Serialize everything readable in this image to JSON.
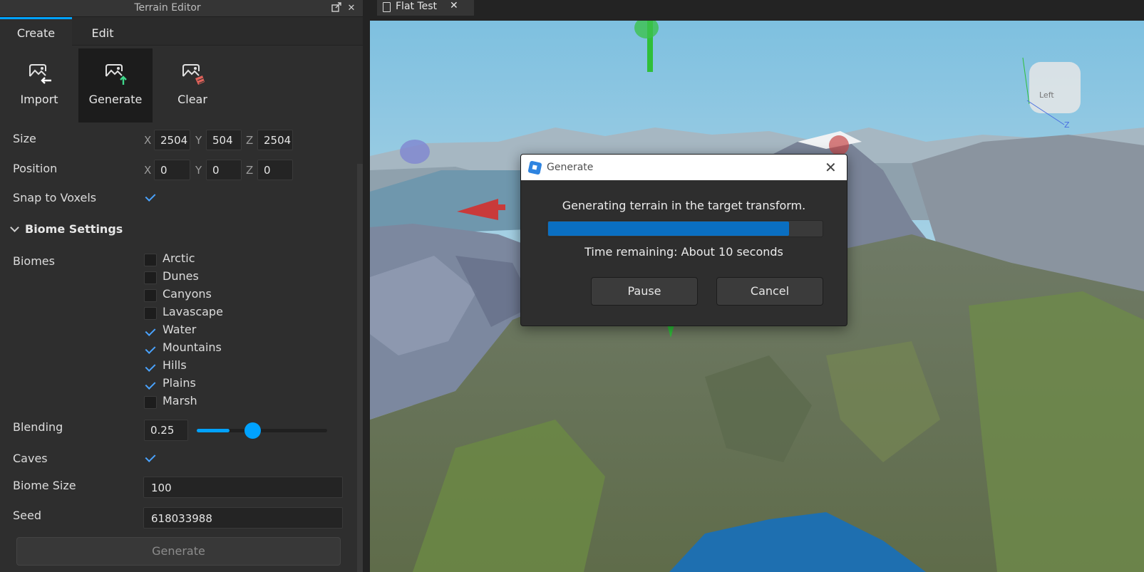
{
  "panel": {
    "title": "Terrain Editor",
    "tabs": [
      {
        "label": "Create",
        "active": true
      },
      {
        "label": "Edit",
        "active": false
      }
    ],
    "tools": [
      {
        "label": "Import",
        "icon": "import-icon"
      },
      {
        "label": "Generate",
        "icon": "generate-icon",
        "active": true
      },
      {
        "label": "Clear",
        "icon": "clear-icon"
      }
    ],
    "size": {
      "label": "Size",
      "x": "2504",
      "y": "504",
      "z": "2504"
    },
    "position": {
      "label": "Position",
      "x": "0",
      "y": "0",
      "z": "0"
    },
    "axes": {
      "x": "X",
      "y": "Y",
      "z": "Z"
    },
    "snap": {
      "label": "Snap to Voxels",
      "checked": true
    },
    "biome_section": "Biome Settings",
    "biomes_label": "Biomes",
    "biomes": [
      {
        "label": "Arctic",
        "checked": false
      },
      {
        "label": "Dunes",
        "checked": false
      },
      {
        "label": "Canyons",
        "checked": false
      },
      {
        "label": "Lavascape",
        "checked": false
      },
      {
        "label": "Water",
        "checked": true
      },
      {
        "label": "Mountains",
        "checked": true
      },
      {
        "label": "Hills",
        "checked": true
      },
      {
        "label": "Plains",
        "checked": true
      },
      {
        "label": "Marsh",
        "checked": false
      }
    ],
    "blending": {
      "label": "Blending",
      "value": "0.25",
      "fraction": 0.25
    },
    "caves": {
      "label": "Caves",
      "checked": true
    },
    "biome_size": {
      "label": "Biome Size",
      "value": "100"
    },
    "seed": {
      "label": "Seed",
      "value": "618033988"
    },
    "generate_button": "Generate"
  },
  "document": {
    "tab_label": "Flat Test"
  },
  "viewcube": {
    "face": "Left",
    "axis_label": "Z"
  },
  "dialog": {
    "title": "Generate",
    "message": "Generating terrain in the target transform.",
    "progress": 0.88,
    "time_remaining": "Time remaining: About 10 seconds",
    "pause": "Pause",
    "cancel": "Cancel"
  },
  "colors": {
    "accent": "#00a2ff",
    "progress": "#0a6fc2",
    "panel_bg": "#2e2e2e"
  }
}
